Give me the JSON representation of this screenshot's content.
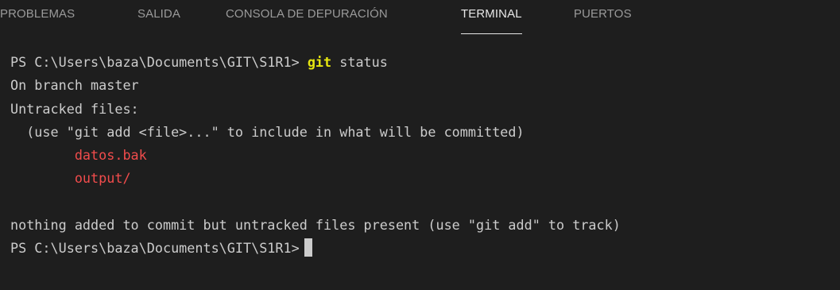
{
  "tabs": [
    {
      "label": "PROBLEMAS"
    },
    {
      "label": "SALIDA"
    },
    {
      "label": "CONSOLA DE DEPURACIÓN"
    },
    {
      "label": "TERMINAL"
    },
    {
      "label": "PUERTOS"
    }
  ],
  "active_tab": "TERMINAL",
  "terminal": {
    "prompt": "PS C:\\Users\\baza\\Documents\\GIT\\S1R1>",
    "command_keyword": "git",
    "command_args": "status",
    "line_branch": "On branch master",
    "line_untracked": "Untracked files:",
    "line_hint": "  (use \"git add <file>...\" to include in what will be committed)",
    "indent": "        ",
    "files": [
      "datos.bak",
      "output/"
    ],
    "line_nothing": "nothing added to commit but untracked files present (use \"git add\" to track)"
  },
  "colors": {
    "background": "#1e1e1e",
    "text": "#cccccc",
    "keyword": "#e5e510",
    "untracked_file": "#f14c4c",
    "tab_active": "#e7e7e7",
    "tab_inactive": "#9a9a9a"
  }
}
